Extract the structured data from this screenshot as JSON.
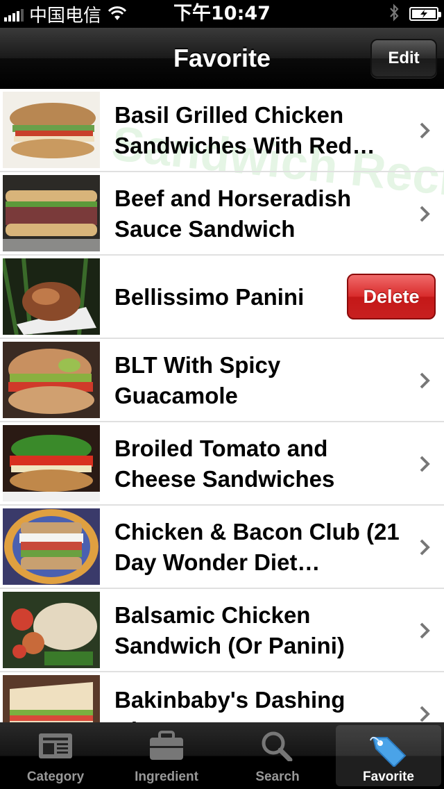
{
  "status_bar": {
    "carrier": "中国电信",
    "time": "下午10:47"
  },
  "nav": {
    "title": "Favorite",
    "edit_label": "Edit"
  },
  "list": {
    "watermark": "Sandwich Recipes",
    "delete_label": "Delete",
    "items": [
      {
        "title": "Basil Grilled Chicken Sandwiches With Red…",
        "show_delete": false
      },
      {
        "title": "Beef and Horseradish Sauce Sandwich",
        "show_delete": false
      },
      {
        "title": "Bellissimo Panini",
        "show_delete": true
      },
      {
        "title": "BLT With Spicy Guacamole",
        "show_delete": false
      },
      {
        "title": "Broiled Tomato and Cheese Sandwiches",
        "show_delete": false
      },
      {
        "title": "Chicken & Bacon Club (21 Day Wonder Diet…",
        "show_delete": false
      },
      {
        "title": "Balsamic Chicken Sandwich (Or Panini)",
        "show_delete": false
      },
      {
        "title": "Bakinbaby's Dashing Alt…",
        "show_delete": false
      }
    ]
  },
  "tabs": [
    {
      "label": "Category",
      "icon": "newspaper-icon",
      "active": false
    },
    {
      "label": "Ingredient",
      "icon": "briefcase-icon",
      "active": false
    },
    {
      "label": "Search",
      "icon": "magnifier-icon",
      "active": false
    },
    {
      "label": "Favorite",
      "icon": "tag-icon",
      "active": true
    }
  ],
  "colors": {
    "delete_red": "#d82b2b",
    "active_tab_blue": "#4aa3e8"
  }
}
